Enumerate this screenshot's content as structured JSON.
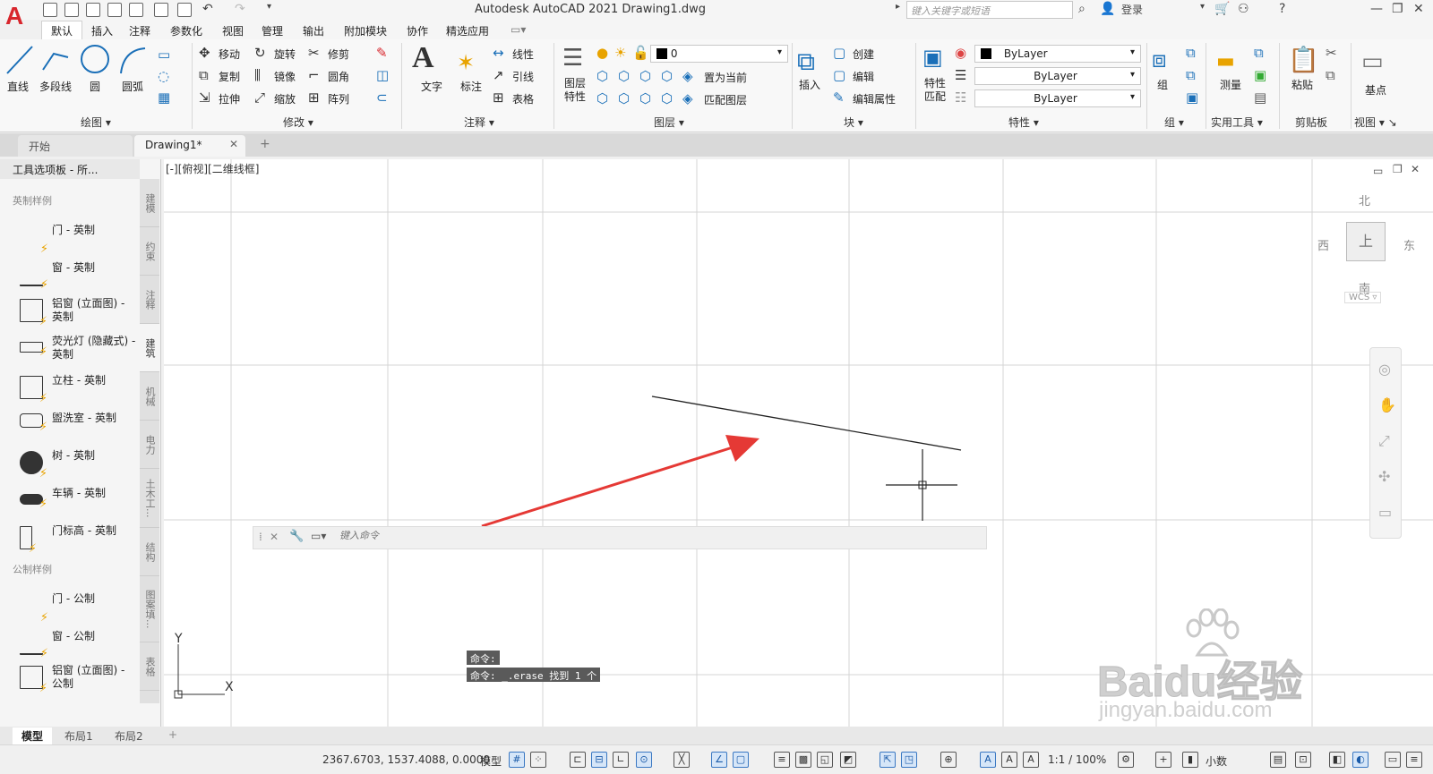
{
  "titlebar": {
    "title": "Autodesk AutoCAD 2021    Drawing1.dwg",
    "search_placeholder": "键入关键字或短语",
    "login": "登录"
  },
  "menu": [
    "默认",
    "插入",
    "注释",
    "参数化",
    "视图",
    "管理",
    "输出",
    "附加模块",
    "协作",
    "精选应用"
  ],
  "ribbon": {
    "draw": {
      "title": "绘图",
      "line": "直线",
      "polyline": "多段线",
      "circle": "圆",
      "arc": "圆弧"
    },
    "modify": {
      "title": "修改",
      "move": "移动",
      "rotate": "旋转",
      "trim": "修剪",
      "copy": "复制",
      "mirror": "镜像",
      "fillet": "圆角",
      "stretch": "拉伸",
      "scale": "缩放",
      "array": "阵列"
    },
    "annotation": {
      "title": "注释",
      "text": "文字",
      "dimension": "标注",
      "linear": "线性",
      "leader": "引线",
      "table": "表格"
    },
    "layers": {
      "title": "图层",
      "layer_props": "图层\n特性",
      "current_layer": "0",
      "make_current": "置为当前",
      "match_layer": "匹配图层"
    },
    "block": {
      "title": "块",
      "insert": "插入",
      "create": "创建",
      "edit": "编辑",
      "edit_attr": "编辑属性"
    },
    "properties": {
      "title": "特性",
      "match": "特性\n匹配",
      "color": "ByLayer",
      "linetype": "ByLayer",
      "lineweight": "ByLayer"
    },
    "groups": {
      "title": "组",
      "group": "组"
    },
    "utilities": {
      "title": "实用工具",
      "measure": "测量"
    },
    "clipboard": {
      "title": "剪贴板",
      "paste": "粘贴"
    },
    "view": {
      "title": "视图",
      "base": "基点"
    }
  },
  "doc_tabs": [
    "开始",
    "Drawing1*"
  ],
  "palette": {
    "title": "工具选项板 - 所...",
    "group_imperial": "英制样例",
    "group_metric": "公制样例",
    "imperial_items": [
      "门 - 英制",
      "窗 - 英制",
      "铝窗 (立面图) - 英制",
      "荧光灯 (隐藏式) - 英制",
      "立柱 - 英制",
      "盥洗室 - 英制",
      "树 - 英制",
      "车辆 - 英制",
      "门标高 - 英制"
    ],
    "metric_items": [
      "门 - 公制",
      "窗 - 公制",
      "铝窗 (立面图) - 公制"
    ],
    "side_tabs": [
      "建模",
      "约束",
      "注释",
      "建筑",
      "机械",
      "电力",
      "土木工...",
      "结构",
      "图案填...",
      "表格"
    ]
  },
  "canvas": {
    "viewport_label": "[-][俯视][二维线框]",
    "viewcube": {
      "north": "北",
      "south": "南",
      "east": "东",
      "west": "西",
      "face": "上",
      "wcs": "WCS"
    },
    "ucs_x": "X",
    "ucs_y": "Y"
  },
  "command": {
    "history_1": "命令:",
    "history_2": "命令: _.erase 找到 1 个",
    "placeholder": "键入命令"
  },
  "layout_tabs": [
    "模型",
    "布局1",
    "布局2"
  ],
  "status": {
    "coords": "2367.6703, 1537.4088, 0.0000",
    "model": "模型",
    "scale": "1:1 / 100%",
    "units": "小数"
  },
  "watermark": {
    "brand": "Baidu经验",
    "url": "jingyan.baidu.com"
  },
  "colors": {
    "accent": "#1a6fb8",
    "logo": "#d8262d",
    "arrow": "#e53935"
  }
}
